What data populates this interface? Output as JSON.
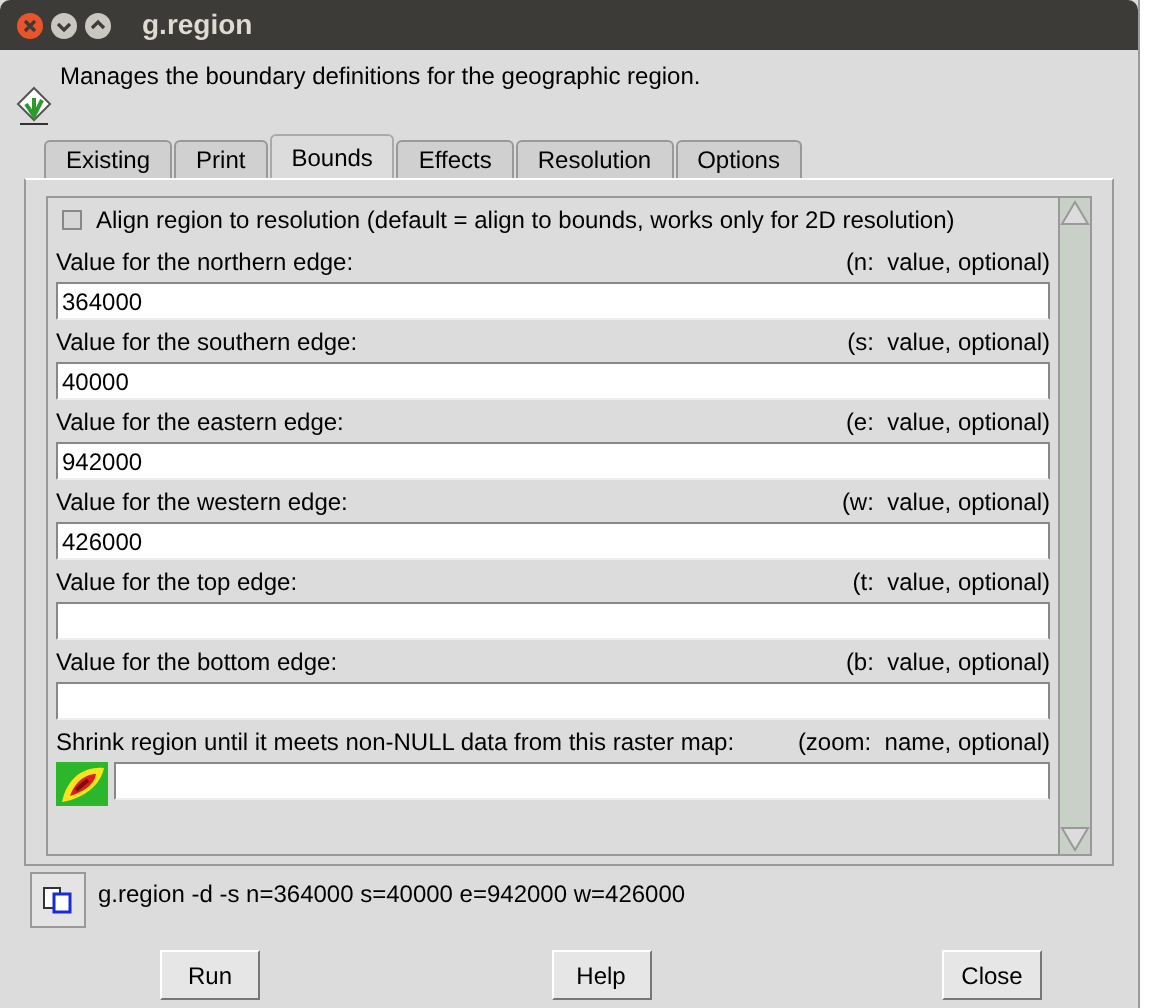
{
  "window": {
    "title": "g.region"
  },
  "description": "Manages the boundary definitions for the geographic region.",
  "tabs": [
    {
      "label": "Existing",
      "selected": false
    },
    {
      "label": "Print",
      "selected": false
    },
    {
      "label": "Bounds",
      "selected": true
    },
    {
      "label": "Effects",
      "selected": false
    },
    {
      "label": "Resolution",
      "selected": false
    },
    {
      "label": "Options",
      "selected": false
    }
  ],
  "options": [
    {
      "kind": "checkbox",
      "label": "Align region to resolution (default = align to bounds, works only for 2D resolution)",
      "checked": false
    },
    {
      "kind": "text",
      "label": "Value for the northern edge:",
      "hint": "(n:  value, optional)",
      "value": "364000"
    },
    {
      "kind": "text",
      "label": "Value for the southern edge:",
      "hint": "(s:  value, optional)",
      "value": "40000"
    },
    {
      "kind": "text",
      "label": "Value for the eastern edge:",
      "hint": "(e:  value, optional)",
      "value": "942000"
    },
    {
      "kind": "text",
      "label": "Value for the western edge:",
      "hint": "(w:  value, optional)",
      "value": "426000"
    },
    {
      "kind": "text",
      "label": "Value for the top edge:",
      "hint": "(t:  value, optional)"
    },
    {
      "kind": "text",
      "label": "Value for the bottom edge:",
      "hint": "(b:  value, optional)"
    },
    {
      "kind": "map",
      "label": "Shrink region until it meets non-NULL data from this raster map:",
      "hint": "(zoom:  name, optional)"
    }
  ],
  "command": "g.region -d -s n=364000 s=40000 e=942000 w=426000",
  "buttons": [
    "Run",
    "Help",
    "Close"
  ]
}
